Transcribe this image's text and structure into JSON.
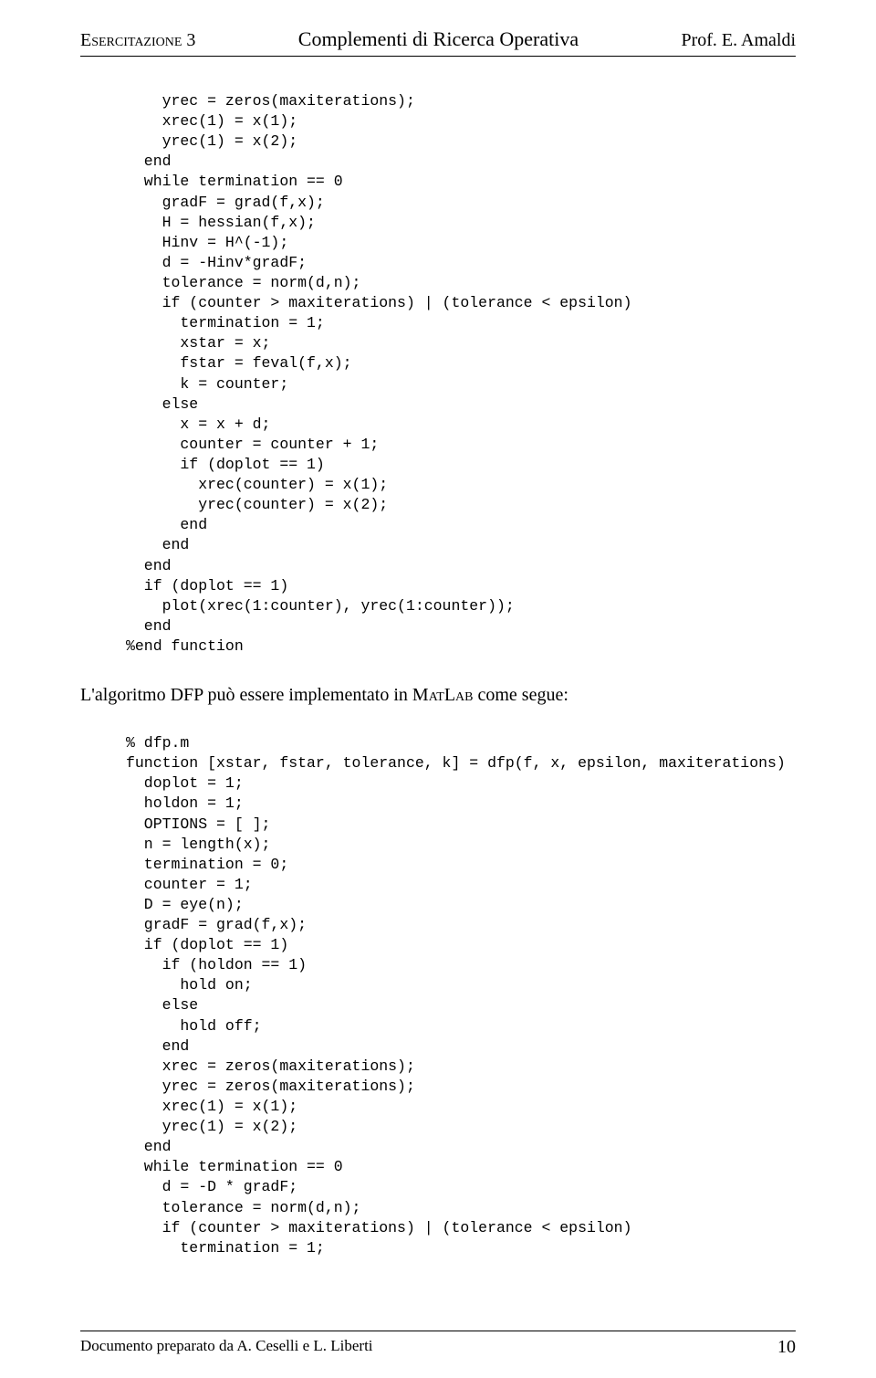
{
  "header": {
    "left": "Esercitazione 3",
    "center": "Complementi di Ricerca Operativa",
    "right": "Prof. E. Amaldi"
  },
  "code1": "    yrec = zeros(maxiterations);\n    xrec(1) = x(1);\n    yrec(1) = x(2);\n  end\n  while termination == 0\n    gradF = grad(f,x);\n    H = hessian(f,x);\n    Hinv = H^(-1);\n    d = -Hinv*gradF;\n    tolerance = norm(d,n);\n    if (counter > maxiterations) | (tolerance < epsilon)\n      termination = 1;\n      xstar = x;\n      fstar = feval(f,x);\n      k = counter;\n    else\n      x = x + d;\n      counter = counter + 1;\n      if (doplot == 1)\n        xrec(counter) = x(1);\n        yrec(counter) = x(2);\n      end\n    end\n  end\n  if (doplot == 1)\n    plot(xrec(1:counter), yrec(1:counter));\n  end\n%end function",
  "para1_pre": "L'algoritmo DFP può essere implementato in ",
  "para1_sc": "MatLab",
  "para1_post": " come segue:",
  "code2": "% dfp.m\nfunction [xstar, fstar, tolerance, k] = dfp(f, x, epsilon, maxiterations)\n  doplot = 1;\n  holdon = 1;\n  OPTIONS = [ ];\n  n = length(x);\n  termination = 0;\n  counter = 1;\n  D = eye(n);\n  gradF = grad(f,x);\n  if (doplot == 1)\n    if (holdon == 1)\n      hold on;\n    else\n      hold off;\n    end\n    xrec = zeros(maxiterations);\n    yrec = zeros(maxiterations);\n    xrec(1) = x(1);\n    yrec(1) = x(2);\n  end\n  while termination == 0\n    d = -D * gradF;\n    tolerance = norm(d,n);\n    if (counter > maxiterations) | (tolerance < epsilon)\n      termination = 1;",
  "footer": {
    "text": "Documento preparato da A. Ceselli e L. Liberti",
    "page": "10"
  }
}
